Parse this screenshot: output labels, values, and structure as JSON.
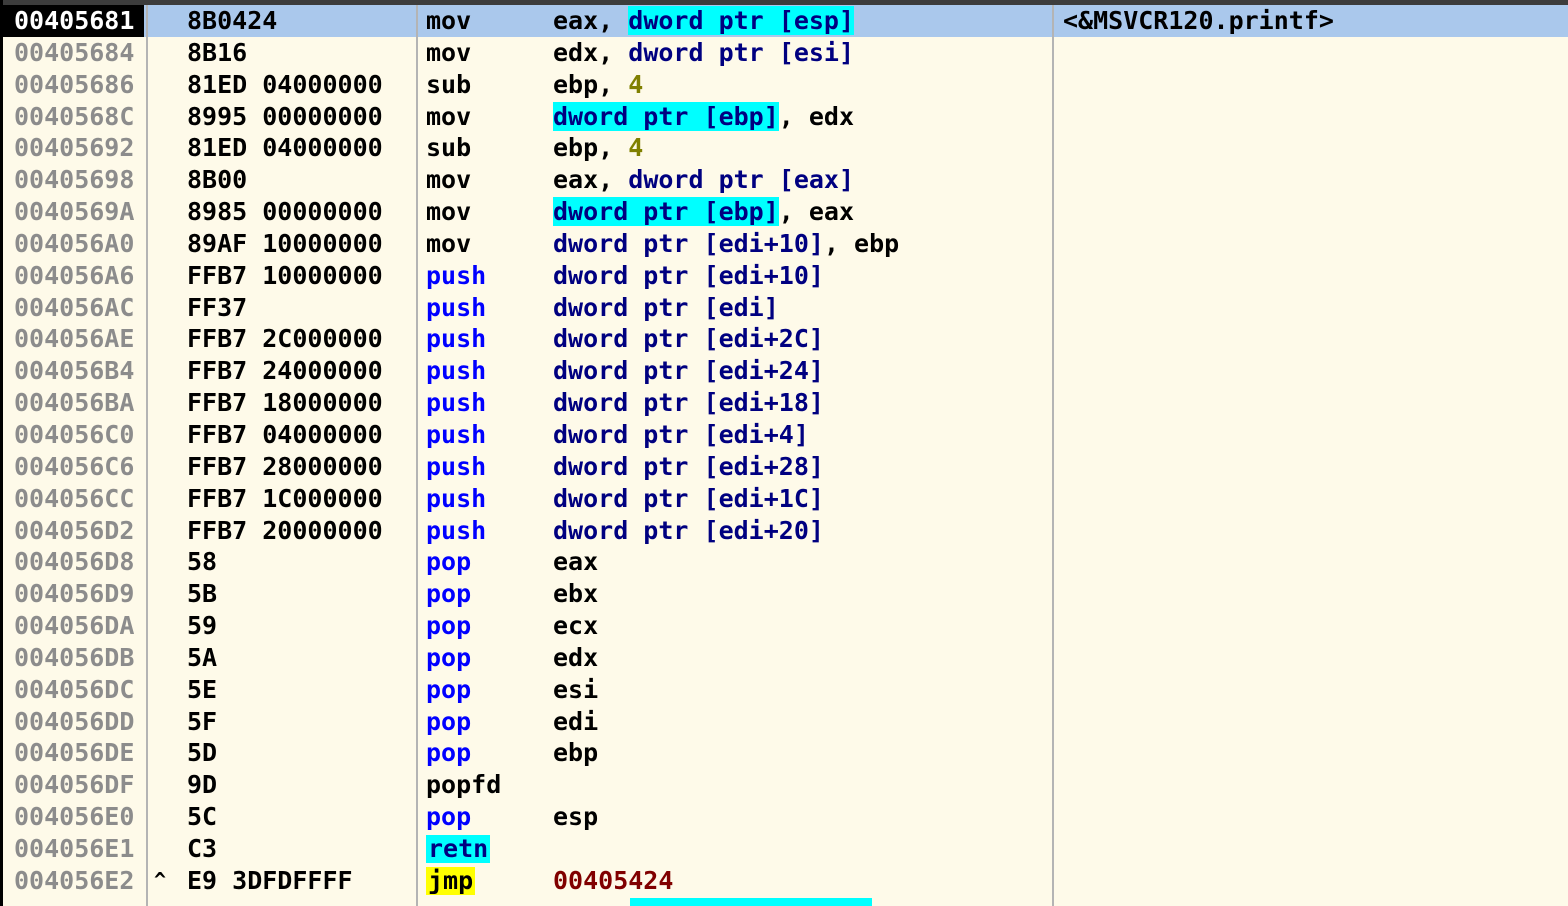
{
  "rows": [
    {
      "addr": "00405681",
      "arrow": "",
      "bytes": "8B0424",
      "mnem": "mov",
      "mnem_style": "",
      "ops": [
        {
          "t": "reg",
          "v": "eax, "
        },
        {
          "t": "memhl",
          "v": "dword ptr [esp]"
        }
      ],
      "comment": "<&MSVCR120.printf>",
      "selected": true
    },
    {
      "addr": "00405684",
      "arrow": "",
      "bytes": "8B16",
      "mnem": "mov",
      "mnem_style": "",
      "ops": [
        {
          "t": "reg",
          "v": "edx, "
        },
        {
          "t": "mem",
          "v": "dword ptr [esi]"
        }
      ],
      "comment": ""
    },
    {
      "addr": "00405686",
      "arrow": "",
      "bytes": "81ED 04000000",
      "mnem": "sub",
      "mnem_style": "",
      "ops": [
        {
          "t": "reg",
          "v": "ebp, "
        },
        {
          "t": "imm",
          "v": "4"
        }
      ],
      "comment": ""
    },
    {
      "addr": "0040568C",
      "arrow": "",
      "bytes": "8995 00000000",
      "mnem": "mov",
      "mnem_style": "",
      "ops": [
        {
          "t": "memhl",
          "v": "dword ptr [ebp]"
        },
        {
          "t": "reg",
          "v": ", edx"
        }
      ],
      "comment": ""
    },
    {
      "addr": "00405692",
      "arrow": "",
      "bytes": "81ED 04000000",
      "mnem": "sub",
      "mnem_style": "",
      "ops": [
        {
          "t": "reg",
          "v": "ebp, "
        },
        {
          "t": "imm",
          "v": "4"
        }
      ],
      "comment": ""
    },
    {
      "addr": "00405698",
      "arrow": "",
      "bytes": "8B00",
      "mnem": "mov",
      "mnem_style": "",
      "ops": [
        {
          "t": "reg",
          "v": "eax, "
        },
        {
          "t": "mem",
          "v": "dword ptr [eax]"
        }
      ],
      "comment": ""
    },
    {
      "addr": "0040569A",
      "arrow": "",
      "bytes": "8985 00000000",
      "mnem": "mov",
      "mnem_style": "",
      "ops": [
        {
          "t": "memhl",
          "v": "dword ptr [ebp]"
        },
        {
          "t": "reg",
          "v": ", eax"
        }
      ],
      "comment": ""
    },
    {
      "addr": "004056A0",
      "arrow": "",
      "bytes": "89AF 10000000",
      "mnem": "mov",
      "mnem_style": "",
      "ops": [
        {
          "t": "mem",
          "v": "dword ptr [edi+10]"
        },
        {
          "t": "reg",
          "v": ", ebp"
        }
      ],
      "comment": ""
    },
    {
      "addr": "004056A6",
      "arrow": "",
      "bytes": "FFB7 10000000",
      "mnem": "push",
      "mnem_style": "blue",
      "ops": [
        {
          "t": "mem",
          "v": "dword ptr [edi+10]"
        }
      ],
      "comment": ""
    },
    {
      "addr": "004056AC",
      "arrow": "",
      "bytes": "FF37",
      "mnem": "push",
      "mnem_style": "blue",
      "ops": [
        {
          "t": "mem",
          "v": "dword ptr [edi]"
        }
      ],
      "comment": ""
    },
    {
      "addr": "004056AE",
      "arrow": "",
      "bytes": "FFB7 2C000000",
      "mnem": "push",
      "mnem_style": "blue",
      "ops": [
        {
          "t": "mem",
          "v": "dword ptr [edi+2C]"
        }
      ],
      "comment": ""
    },
    {
      "addr": "004056B4",
      "arrow": "",
      "bytes": "FFB7 24000000",
      "mnem": "push",
      "mnem_style": "blue",
      "ops": [
        {
          "t": "mem",
          "v": "dword ptr [edi+24]"
        }
      ],
      "comment": ""
    },
    {
      "addr": "004056BA",
      "arrow": "",
      "bytes": "FFB7 18000000",
      "mnem": "push",
      "mnem_style": "blue",
      "ops": [
        {
          "t": "mem",
          "v": "dword ptr [edi+18]"
        }
      ],
      "comment": ""
    },
    {
      "addr": "004056C0",
      "arrow": "",
      "bytes": "FFB7 04000000",
      "mnem": "push",
      "mnem_style": "blue",
      "ops": [
        {
          "t": "mem",
          "v": "dword ptr [edi+4]"
        }
      ],
      "comment": ""
    },
    {
      "addr": "004056C6",
      "arrow": "",
      "bytes": "FFB7 28000000",
      "mnem": "push",
      "mnem_style": "blue",
      "ops": [
        {
          "t": "mem",
          "v": "dword ptr [edi+28]"
        }
      ],
      "comment": ""
    },
    {
      "addr": "004056CC",
      "arrow": "",
      "bytes": "FFB7 1C000000",
      "mnem": "push",
      "mnem_style": "blue",
      "ops": [
        {
          "t": "mem",
          "v": "dword ptr [edi+1C]"
        }
      ],
      "comment": ""
    },
    {
      "addr": "004056D2",
      "arrow": "",
      "bytes": "FFB7 20000000",
      "mnem": "push",
      "mnem_style": "blue",
      "ops": [
        {
          "t": "mem",
          "v": "dword ptr [edi+20]"
        }
      ],
      "comment": ""
    },
    {
      "addr": "004056D8",
      "arrow": "",
      "bytes": "58",
      "mnem": "pop",
      "mnem_style": "blue",
      "ops": [
        {
          "t": "reg",
          "v": "eax"
        }
      ],
      "comment": ""
    },
    {
      "addr": "004056D9",
      "arrow": "",
      "bytes": "5B",
      "mnem": "pop",
      "mnem_style": "blue",
      "ops": [
        {
          "t": "reg",
          "v": "ebx"
        }
      ],
      "comment": ""
    },
    {
      "addr": "004056DA",
      "arrow": "",
      "bytes": "59",
      "mnem": "pop",
      "mnem_style": "blue",
      "ops": [
        {
          "t": "reg",
          "v": "ecx"
        }
      ],
      "comment": ""
    },
    {
      "addr": "004056DB",
      "arrow": "",
      "bytes": "5A",
      "mnem": "pop",
      "mnem_style": "blue",
      "ops": [
        {
          "t": "reg",
          "v": "edx"
        }
      ],
      "comment": ""
    },
    {
      "addr": "004056DC",
      "arrow": "",
      "bytes": "5E",
      "mnem": "pop",
      "mnem_style": "blue",
      "ops": [
        {
          "t": "reg",
          "v": "esi"
        }
      ],
      "comment": ""
    },
    {
      "addr": "004056DD",
      "arrow": "",
      "bytes": "5F",
      "mnem": "pop",
      "mnem_style": "blue",
      "ops": [
        {
          "t": "reg",
          "v": "edi"
        }
      ],
      "comment": ""
    },
    {
      "addr": "004056DE",
      "arrow": "",
      "bytes": "5D",
      "mnem": "pop",
      "mnem_style": "blue",
      "ops": [
        {
          "t": "reg",
          "v": "ebp"
        }
      ],
      "comment": ""
    },
    {
      "addr": "004056DF",
      "arrow": "",
      "bytes": "9D",
      "mnem": "popfd",
      "mnem_style": "",
      "ops": [],
      "comment": ""
    },
    {
      "addr": "004056E0",
      "arrow": "",
      "bytes": "5C",
      "mnem": "pop",
      "mnem_style": "blue",
      "ops": [
        {
          "t": "reg",
          "v": "esp"
        }
      ],
      "comment": ""
    },
    {
      "addr": "004056E1",
      "arrow": "",
      "bytes": "C3",
      "mnem": "retn",
      "mnem_style": "cyanbg",
      "ops": [],
      "comment": ""
    },
    {
      "addr": "004056E2",
      "arrow": "^",
      "bytes": "E9 3DFDFFFF",
      "mnem": "jmp",
      "mnem_style": "yellowbg",
      "ops": [
        {
          "t": "tgt",
          "v": "00405424"
        }
      ],
      "comment": ""
    }
  ]
}
